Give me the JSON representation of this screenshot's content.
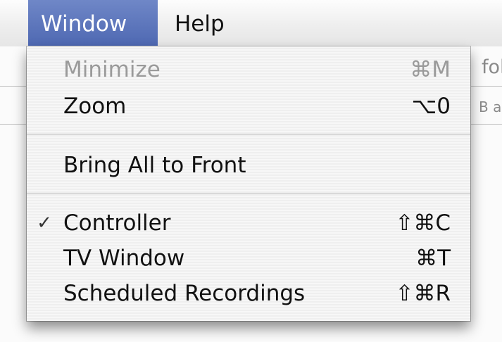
{
  "menubar": {
    "items": [
      {
        "label": "Window",
        "active": true
      },
      {
        "label": "Help",
        "active": false
      }
    ]
  },
  "background": {
    "fragment_1": "fol",
    "fragment_2": "B a"
  },
  "window_menu": {
    "items": [
      {
        "label": "Minimize",
        "shortcut": "⌘M",
        "enabled": false,
        "checked": false
      },
      {
        "label": "Zoom",
        "shortcut": "⌥0",
        "enabled": true,
        "checked": false
      },
      {
        "label": "Bring All to Front",
        "shortcut": "",
        "enabled": true,
        "checked": false
      },
      {
        "label": "Controller",
        "shortcut": "⇧⌘C",
        "enabled": true,
        "checked": true,
        "check_mark": "✓"
      },
      {
        "label": "TV Window",
        "shortcut": "⌘T",
        "enabled": true,
        "checked": false
      },
      {
        "label": "Scheduled Recordings",
        "shortcut": "⇧⌘R",
        "enabled": true,
        "checked": false
      }
    ]
  },
  "colors": {
    "menubar_active_bg": "#5670b8",
    "disabled_text": "#9a9a9a"
  }
}
